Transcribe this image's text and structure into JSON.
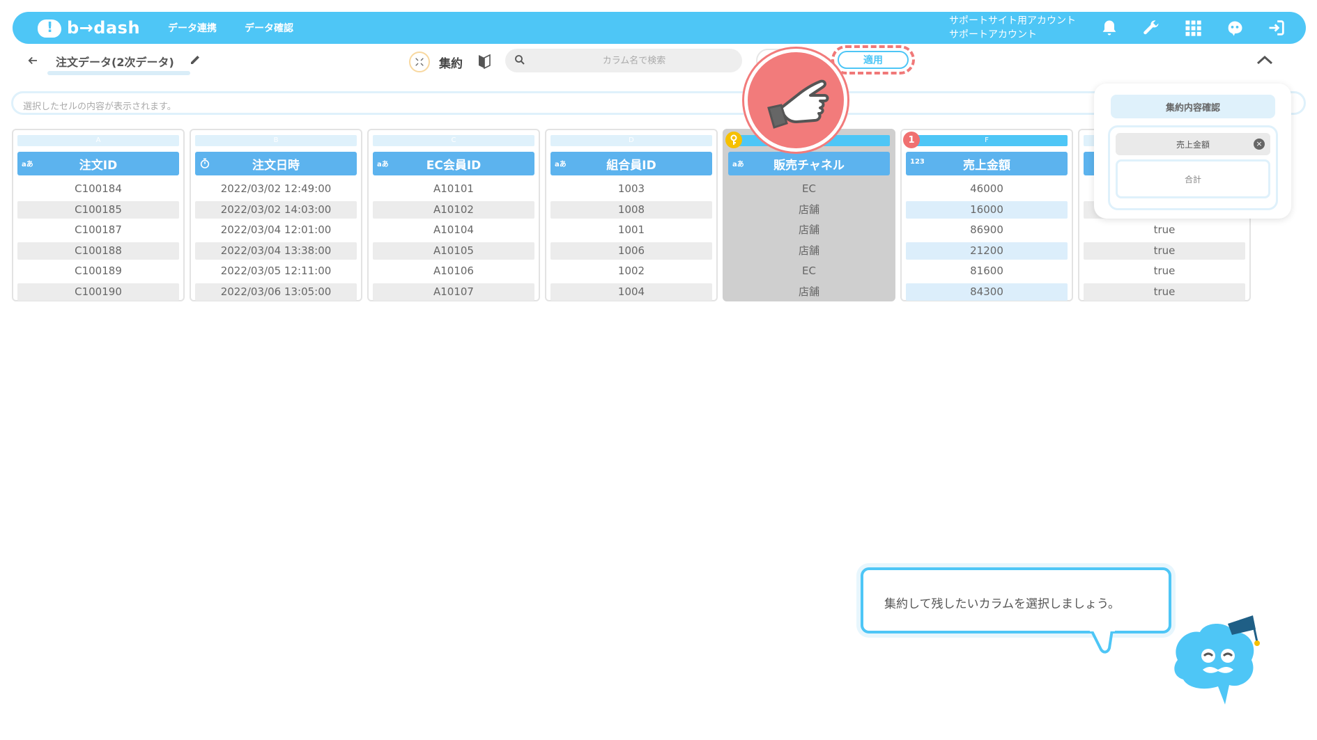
{
  "nav": {
    "logo": "b→dash",
    "links": [
      "データ連携",
      "データ確認"
    ],
    "account_line1": "サポートサイト用アカウント",
    "account_line2": "サポートアカウント"
  },
  "toolbar": {
    "title": "注文データ(2次データ)",
    "aggregate_label": "集約",
    "search_placeholder": "カラム名で検索",
    "apply_label": "適用"
  },
  "cellbar": {
    "placeholder": "選択したセルの内容が表示されます。"
  },
  "columns": [
    {
      "letter": "A",
      "type": "aあ",
      "name": "注文ID",
      "cells": [
        "C100184",
        "C100185",
        "C100187",
        "C100188",
        "C100189",
        "C100190"
      ]
    },
    {
      "letter": "B",
      "type": "clock",
      "name": "注文日時",
      "cells": [
        "2022/03/02 12:49:00",
        "2022/03/02 14:03:00",
        "2022/03/04 12:01:00",
        "2022/03/04 13:38:00",
        "2022/03/05 12:11:00",
        "2022/03/06 13:05:00"
      ]
    },
    {
      "letter": "C",
      "type": "aあ",
      "name": "EC会員ID",
      "cells": [
        "A10101",
        "A10102",
        "A10104",
        "A10105",
        "A10106",
        "A10107"
      ]
    },
    {
      "letter": "D",
      "type": "aあ",
      "name": "組合員ID",
      "cells": [
        "1003",
        "1008",
        "1001",
        "1006",
        "1002",
        "1004"
      ]
    },
    {
      "letter": "",
      "type": "aあ",
      "name": "販売チャネル",
      "cells": [
        "EC",
        "店舗",
        "店舗",
        "店舗",
        "EC",
        "店舗"
      ]
    },
    {
      "letter": "F",
      "type": "123",
      "name": "売上金額",
      "cells": [
        "46000",
        "16000",
        "86900",
        "21200",
        "81600",
        "84300"
      ],
      "badge": "1"
    },
    {
      "letter": "",
      "type": "",
      "name": "",
      "cells": [
        "",
        "",
        "true",
        "true",
        "true",
        "true"
      ]
    }
  ],
  "agg_panel": {
    "title": "集約内容確認",
    "item": "売上金額",
    "method": "合計"
  },
  "tip": {
    "text": "集約して残したいカラムを選択しましょう。"
  },
  "colors": {
    "primary": "#4ec6f6",
    "header": "#5cb3ee",
    "highlight": "#f27b7b"
  }
}
